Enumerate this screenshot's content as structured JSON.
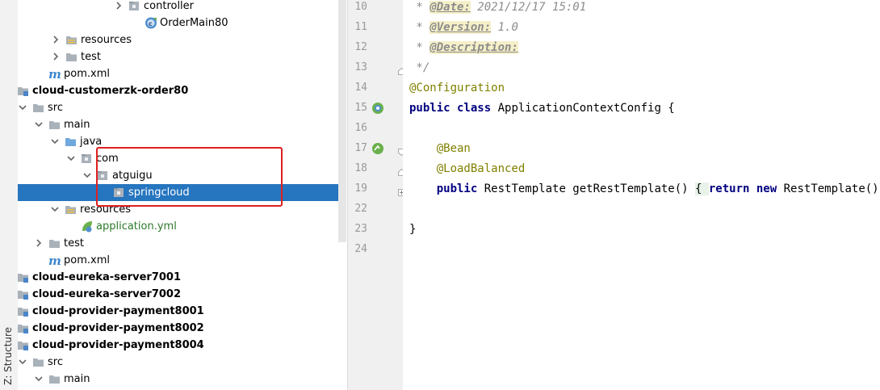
{
  "toolstrip": {
    "structure_label": "Z: Structure"
  },
  "tree": {
    "items": [
      {
        "label": "controller",
        "kind": "package",
        "bold": false,
        "arrow": "right"
      },
      {
        "label": "OrderMain80",
        "kind": "springclass",
        "bold": false,
        "arrow": "none"
      },
      {
        "label": "resources",
        "kind": "resfolder",
        "bold": false,
        "arrow": "right"
      },
      {
        "label": "test",
        "kind": "folder",
        "bold": false,
        "arrow": "right"
      },
      {
        "label": "pom.xml",
        "kind": "maven",
        "bold": false,
        "arrow": "none"
      },
      {
        "label": "cloud-customerzk-order80",
        "kind": "module",
        "bold": true,
        "arrow": "down"
      },
      {
        "label": "src",
        "kind": "folder",
        "bold": false,
        "arrow": "down"
      },
      {
        "label": "main",
        "kind": "folder",
        "bold": false,
        "arrow": "down"
      },
      {
        "label": "java",
        "kind": "srcfolder",
        "bold": false,
        "arrow": "down"
      },
      {
        "label": "com",
        "kind": "package",
        "bold": false,
        "arrow": "down"
      },
      {
        "label": "atguigu",
        "kind": "package",
        "bold": false,
        "arrow": "down"
      },
      {
        "label": "springcloud",
        "kind": "package",
        "bold": false,
        "arrow": "none",
        "selected": true
      },
      {
        "label": "resources",
        "kind": "resfolder",
        "bold": false,
        "arrow": "down"
      },
      {
        "label": "application.yml",
        "kind": "yml",
        "bold": false,
        "arrow": "none"
      },
      {
        "label": "test",
        "kind": "folder",
        "bold": false,
        "arrow": "right"
      },
      {
        "label": "pom.xml",
        "kind": "maven",
        "bold": false,
        "arrow": "none"
      },
      {
        "label": "cloud-eureka-server7001",
        "kind": "module",
        "bold": true,
        "arrow": "right"
      },
      {
        "label": "cloud-eureka-server7002",
        "kind": "module",
        "bold": true,
        "arrow": "right"
      },
      {
        "label": "cloud-provider-payment8001",
        "kind": "module",
        "bold": true,
        "arrow": "right"
      },
      {
        "label": "cloud-provider-payment8002",
        "kind": "module",
        "bold": true,
        "arrow": "right"
      },
      {
        "label": "cloud-provider-payment8004",
        "kind": "module",
        "bold": true,
        "arrow": "down"
      },
      {
        "label": "src",
        "kind": "folder",
        "bold": false,
        "arrow": "down"
      },
      {
        "label": "main",
        "kind": "folder",
        "bold": false,
        "arrow": "down"
      }
    ]
  },
  "editor": {
    "lines": [
      {
        "no": "10",
        "parts": [
          {
            "t": " * ",
            "c": "cm"
          },
          {
            "t": "@Date:",
            "c": "tag"
          },
          {
            "t": " 2021/12/17 15:01",
            "c": "cm"
          }
        ]
      },
      {
        "no": "11",
        "parts": [
          {
            "t": " * ",
            "c": "cm"
          },
          {
            "t": "@Version:",
            "c": "tag"
          },
          {
            "t": " 1.0",
            "c": "cm"
          }
        ]
      },
      {
        "no": "12",
        "parts": [
          {
            "t": " * ",
            "c": "cm"
          },
          {
            "t": "@Description:",
            "c": "tag"
          }
        ]
      },
      {
        "no": "13",
        "parts": [
          {
            "t": " */",
            "c": "cm"
          }
        ]
      },
      {
        "no": "14",
        "parts": [
          {
            "t": "@Configuration",
            "c": "ann"
          }
        ]
      },
      {
        "no": "15",
        "parts": [
          {
            "t": "public class",
            "c": "kw"
          },
          {
            "t": " ApplicationContextConfig {",
            "c": ""
          }
        ]
      },
      {
        "no": "16",
        "parts": []
      },
      {
        "no": "17",
        "parts": [
          {
            "t": "    @Bean",
            "c": "ann"
          }
        ]
      },
      {
        "no": "18",
        "parts": [
          {
            "t": "    @LoadBalanced",
            "c": "ann"
          }
        ]
      },
      {
        "no": "19",
        "parts": [
          {
            "t": "    ",
            "c": ""
          },
          {
            "t": "public",
            "c": "kw"
          },
          {
            "t": " RestTemplate getRestTemplate() ",
            "c": ""
          },
          {
            "t": "{ ",
            "c": "brace"
          },
          {
            "t": "return new",
            "c": "kw"
          },
          {
            "t": " RestTemplate(); ",
            "c": ""
          },
          {
            "t": "}",
            "c": "brace"
          }
        ]
      },
      {
        "no": "22",
        "parts": []
      },
      {
        "no": "23",
        "parts": [
          {
            "t": "}",
            "c": ""
          }
        ]
      },
      {
        "no": "24",
        "parts": []
      }
    ],
    "gutter_icons": [
      {
        "line": "15",
        "icon": "spring-config-icon"
      },
      {
        "line": "17",
        "icon": "spring-bean-icon"
      }
    ],
    "fold_markers": [
      {
        "line": "13",
        "kind": "end"
      },
      {
        "line": "17",
        "kind": "start"
      },
      {
        "line": "18",
        "kind": "end"
      },
      {
        "line": "19",
        "kind": "collapsed"
      }
    ]
  }
}
